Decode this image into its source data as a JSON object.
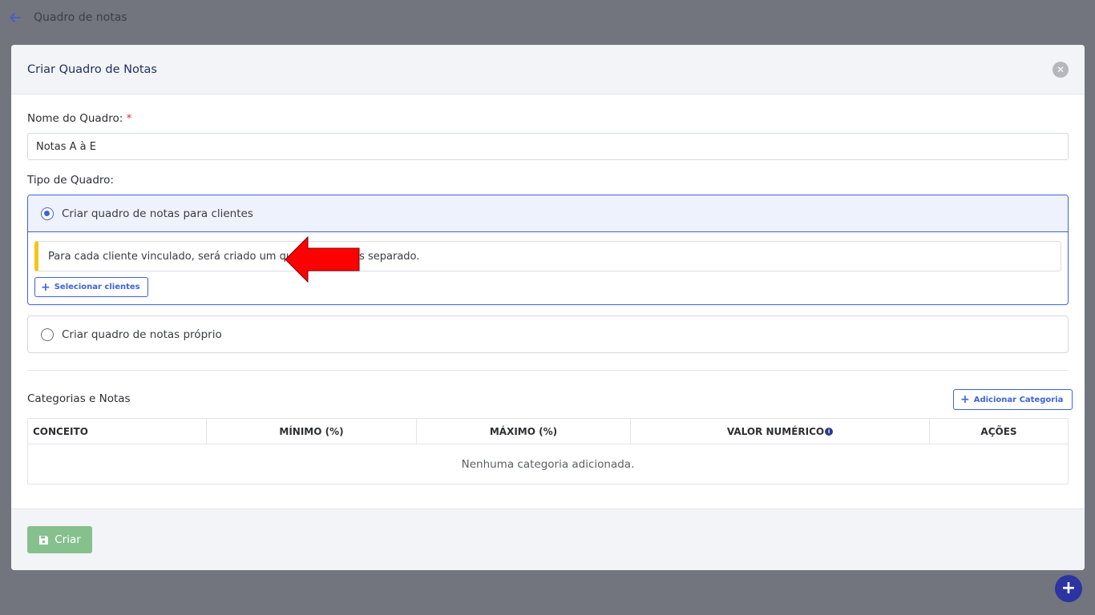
{
  "topbar": {
    "title": "Quadro de notas",
    "back_icon": "arrow-left-icon"
  },
  "modal": {
    "title": "Criar Quadro de Notas",
    "close_icon": "close-icon",
    "name_label": "Nome do Quadro:",
    "required_mark": "*",
    "name_value": "Notas A à E",
    "type_label": "Tipo de Quadro:",
    "option_clients": {
      "label": "Criar quadro de notas para clientes",
      "selected": true,
      "info": "Para cada cliente vinculado, será criado um quadro de notas separado.",
      "select_button": "Selecionar clientes"
    },
    "option_own": {
      "label": "Criar quadro de notas próprio",
      "selected": false
    },
    "categories": {
      "title": "Categorias e Notas",
      "add_button": "Adicionar Categoria",
      "columns": [
        "CONCEITO",
        "MÍNIMO (%)",
        "MÁXIMO (%)",
        "VALOR NUMÉRICO",
        "AÇÕES"
      ],
      "empty_text": "Nenhuma categoria adicionada."
    },
    "footer": {
      "create_button": "Criar"
    }
  },
  "colors": {
    "primary": "#3f63d6",
    "success_disabled": "#86c08d",
    "alert_accent": "#f5c518",
    "annotation_arrow": "#ff0000",
    "fab": "#2b34a0"
  }
}
